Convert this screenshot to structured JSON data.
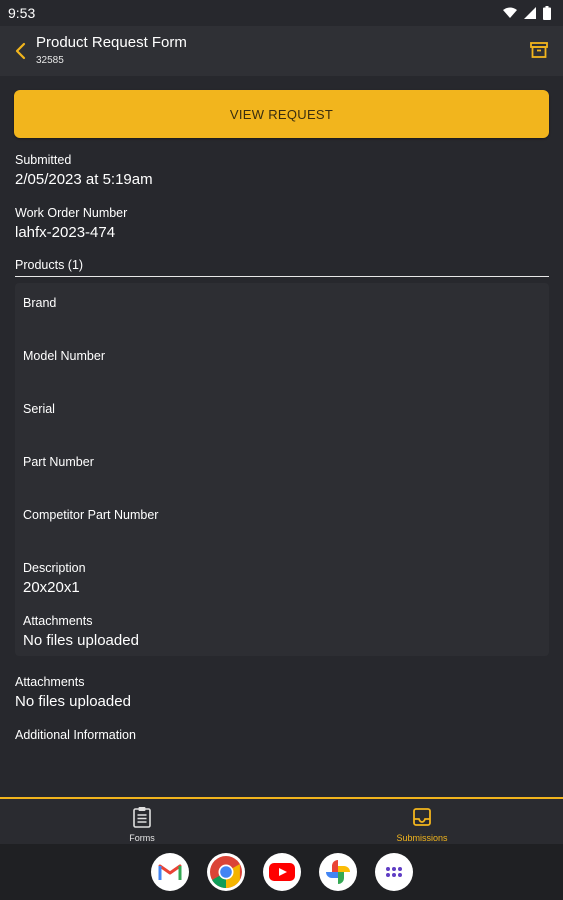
{
  "status_bar": {
    "time": "9:53"
  },
  "app_bar": {
    "title": "Product Request Form",
    "subtitle": "32585"
  },
  "view_request_label": "VIEW REQUEST",
  "submitted": {
    "label": "Submitted",
    "value": "2/05/2023 at 5:19am"
  },
  "work_order": {
    "label": "Work Order Number",
    "value": "lahfx-2023-474"
  },
  "products": {
    "header": "Products (1)",
    "fields": [
      {
        "label": "Brand",
        "value": ""
      },
      {
        "label": "Model Number",
        "value": ""
      },
      {
        "label": "Serial",
        "value": ""
      },
      {
        "label": "Part Number",
        "value": ""
      },
      {
        "label": "Competitor Part Number",
        "value": ""
      },
      {
        "label": "Description",
        "value": "20x20x1"
      },
      {
        "label": "Attachments",
        "value": "No files uploaded"
      }
    ]
  },
  "attachments": {
    "label": "Attachments",
    "value": "No files uploaded"
  },
  "additional_info": {
    "label": "Additional Information"
  },
  "bottom_nav": {
    "forms": {
      "label": "Forms",
      "icon": "clipboard-icon"
    },
    "submissions": {
      "label": "Submissions",
      "icon": "inbox-icon",
      "active": true
    }
  },
  "dock": [
    "gmail",
    "chrome",
    "youtube",
    "photos",
    "app-drawer"
  ],
  "colors": {
    "accent": "#f2b51d",
    "background": "#27282d",
    "card": "#2d2e33"
  }
}
